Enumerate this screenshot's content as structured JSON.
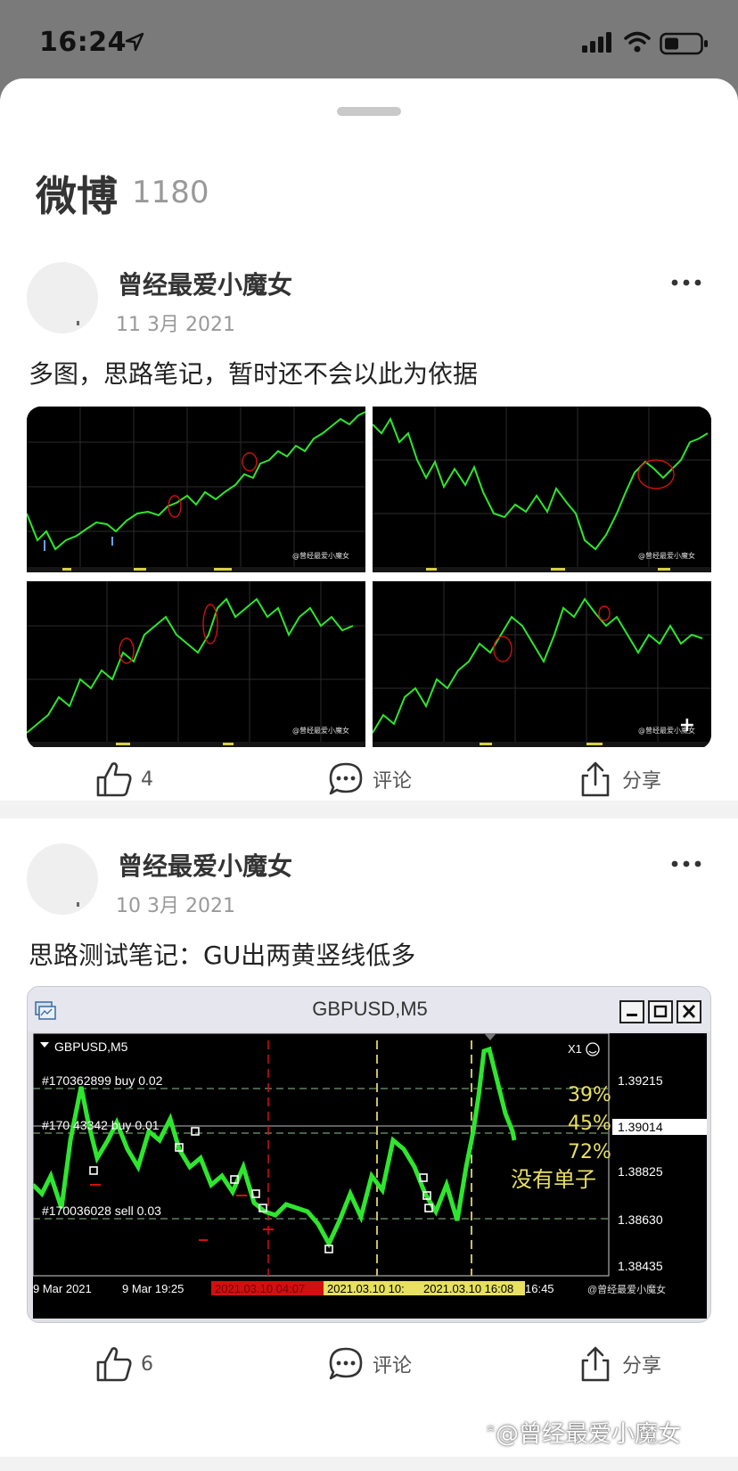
{
  "status_bar": {
    "time": "16:24",
    "icons": [
      "location-arrow-icon",
      "cellular-signal-icon",
      "wifi-icon",
      "battery-icon"
    ]
  },
  "sheet": {
    "title": "微博",
    "count": "1180"
  },
  "posts": [
    {
      "author": "曾经最爱小魔女",
      "date": "11 3月 2021",
      "text": "多图，思路笔记，暂时还不会以此为依据",
      "image_count": 4,
      "watermark": "@曾经最爱小魔女",
      "actions": {
        "like_count": "4",
        "comment_label": "评论",
        "share_label": "分享"
      }
    },
    {
      "author": "曾经最爱小魔女",
      "date": "10 3月 2021",
      "text": "思路测试笔记：GU出两黄竖线低多",
      "chart_window": {
        "window_title": "GBPUSD,M5",
        "symbol_label": "GBPUSD,M5",
        "zoom_label": "X1",
        "orders": [
          "#170362899 buy 0.02",
          "#170 43342 buy 0.01",
          "#170036028 sell 0.03"
        ],
        "prices": [
          "1.39215",
          "1.39014",
          "1.38825",
          "1.38630",
          "1.38435"
        ],
        "current_price": "1.39014",
        "percents": [
          "39%",
          "45%",
          "72%"
        ],
        "note": "没有单子",
        "time_labels": [
          "9 Mar 2021",
          "9 Mar 19:25",
          "2021.03.10 04:07",
          "2021.03.10 10:",
          "2021.03.10 16:08",
          "16:45"
        ],
        "watermark": "@曾经最爱小魔女"
      },
      "actions": {
        "like_count": "6",
        "comment_label": "评论",
        "share_label": "分享"
      }
    }
  ],
  "page_watermark": "@曾经最爱小魔女",
  "colors": {
    "status_bg": "#7a7a7a",
    "chart_line": "#2ee62e",
    "chart_bg": "#000000",
    "marker_red": "#d01010",
    "marker_yellow": "#e8e060"
  }
}
